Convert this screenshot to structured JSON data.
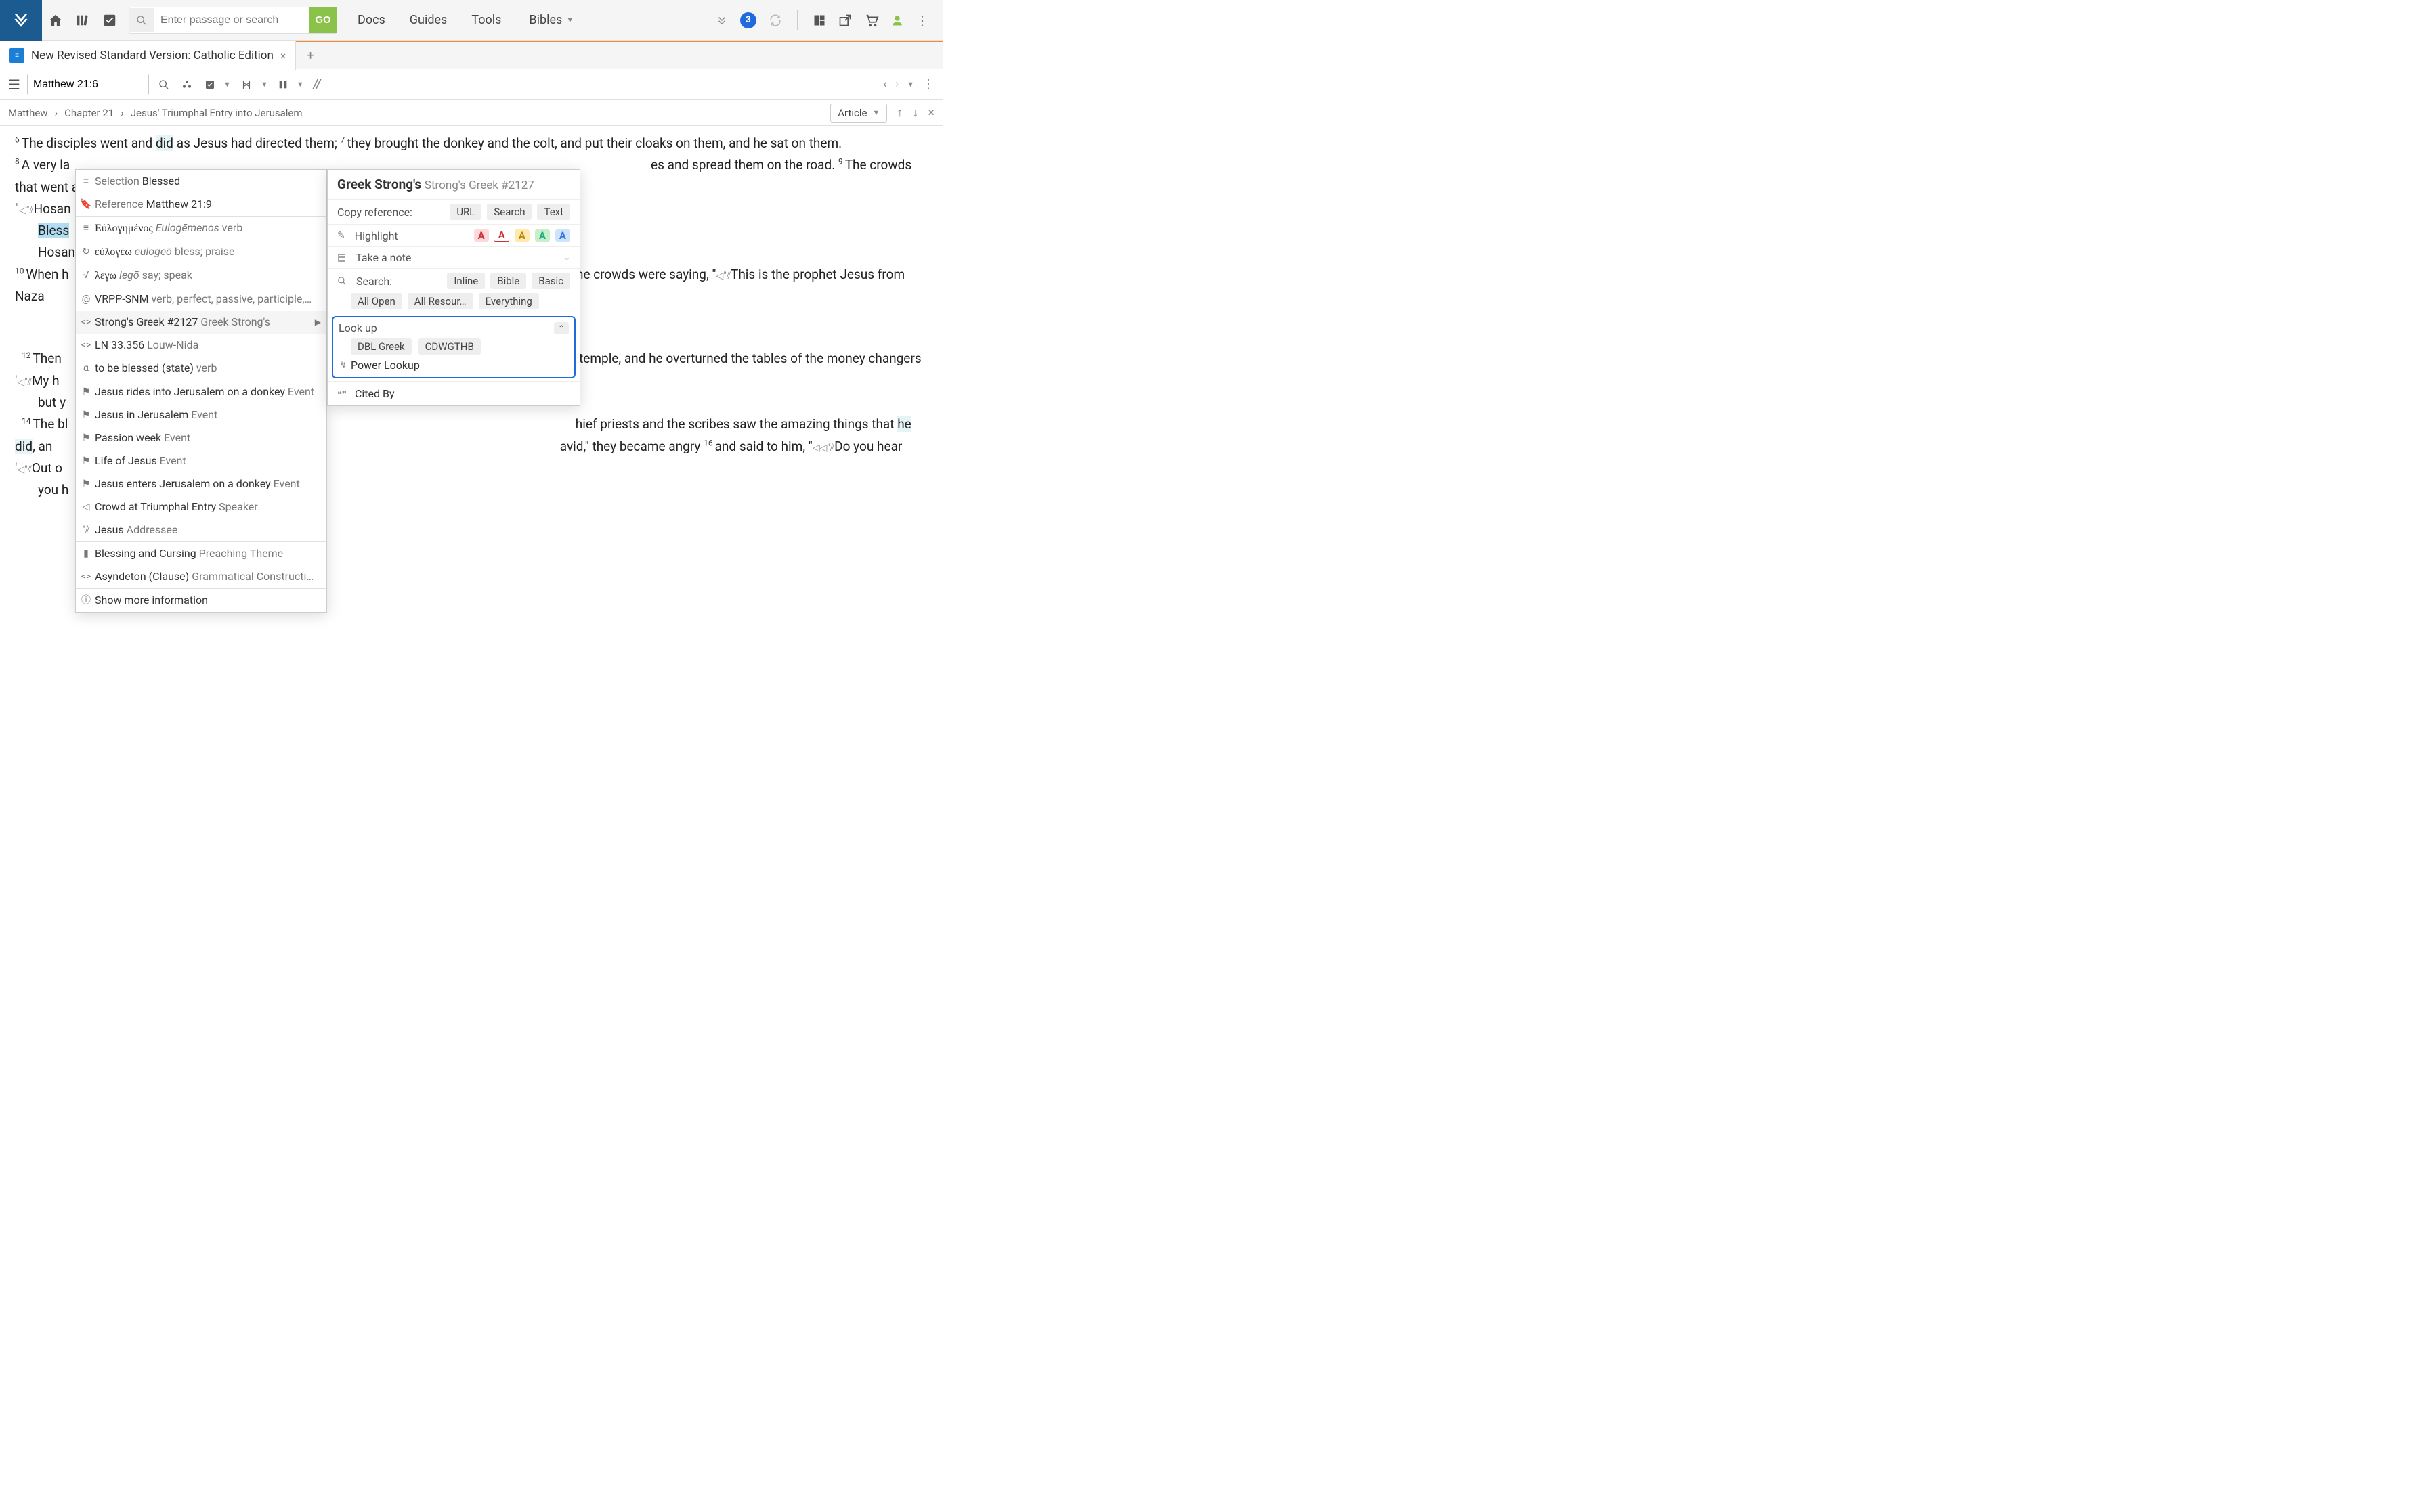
{
  "topbar": {
    "search_placeholder": "Enter passage or search",
    "go": "GO",
    "nav": {
      "docs": "Docs",
      "guides": "Guides",
      "tools": "Tools",
      "bibles": "Bibles"
    },
    "badge": "3"
  },
  "tab": {
    "title": "New Revised Standard Version: Catholic Edition"
  },
  "panel": {
    "reference": "Matthew 21:6"
  },
  "breadcrumb": {
    "b1": "Matthew",
    "b2": "Chapter 21",
    "b3": "Jesus' Triumphal Entry into Jerusalem",
    "article": "Article"
  },
  "verses": {
    "v6": "The disciples went and ",
    "v6_did": "did",
    "v6_rest": " as Jesus had directed them; ",
    "v7": "they brought the donkey and the colt, and put their cloaks on them, and he sat on them.",
    "v8": "A very la",
    "v8_tail": "es and spread them on the road. ",
    "v9a": "The crowds that went ahead of ",
    "v9_hosanna": "Hosan",
    "v9_blessed": "Bless",
    "v9_hosanna2": "Hosan",
    "v10": "When h",
    "v10_tail": "he crowds were saying, \"",
    "v10_tail2": "This is the prophet Jesus from Naza",
    "v12": "Then ",
    "v12_tail": "e temple, and he overturned the tables of the money changers",
    "v13a": "My h",
    "v13b": "but y",
    "v14a": "The bl",
    "v15a": "hief priests and the scribes saw the amazing things that ",
    "v15_hedid": "he did",
    "v15b": ", an",
    "v15c": "avid,\" they became angry ",
    "v16a": "and said to him, \"",
    "v16b": "Do you hear ",
    "v16c": "Out o",
    "v16d": "you h"
  },
  "ctx": {
    "selection_lbl": "Selection",
    "selection": "Blessed",
    "reference_lbl": "Reference",
    "reference": "Matthew 21:9",
    "lemma_gr": "Εὐλογημένος",
    "lemma_tr": "Eulogēmenos",
    "lemma_pos": "verb",
    "root_gr": "εὐλογέω",
    "root_tr": "eulogeō",
    "root_gloss": "bless; praise",
    "lego_gr": "λεγω",
    "lego_tr": "legō",
    "lego_gloss": "say; speak",
    "morph": "VRPP-SNM",
    "morph_gloss": "verb, perfect, passive, participle,…",
    "strongs": "Strong's Greek #2127",
    "strongs_lbl": "Greek Strong's",
    "ln": "LN 33.356",
    "ln_lbl": "Louw-Nida",
    "state": "to be blessed (state)",
    "state_pos": "verb",
    "ev1": "Jesus rides into Jerusalem on a donkey",
    "ev1_lbl": "Event",
    "ev2": "Jesus in Jerusalem",
    "ev2_lbl": "Event",
    "ev3": "Passion week",
    "ev3_lbl": "Event",
    "ev4": "Life of Jesus",
    "ev4_lbl": "Event",
    "ev5": "Jesus enters Jerusalem on a donkey",
    "ev5_lbl": "Event",
    "sp": "Crowd at Triumphal Entry",
    "sp_lbl": "Speaker",
    "addr": "Jesus",
    "addr_lbl": "Addressee",
    "theme": "Blessing and Cursing",
    "theme_lbl": "Preaching Theme",
    "gram": "Asyndeton (Clause)",
    "gram_lbl": "Grammatical Constructi…",
    "more": "Show more information"
  },
  "rpanel": {
    "title": "Greek Strong's",
    "subtitle": "Strong's Greek #2127",
    "copyref": "Copy reference:",
    "url": "URL",
    "search": "Search",
    "text": "Text",
    "highlight": "Highlight",
    "note": "Take a note",
    "search_lbl": "Search:",
    "inline": "Inline",
    "bible": "Bible",
    "basic": "Basic",
    "allopen": "All Open",
    "allres": "All Resour…",
    "everything": "Everything",
    "lookup": "Look up",
    "dbl": "DBL Greek",
    "cdw": "CDWGTHB",
    "power": "Power Lookup",
    "cited": "Cited By"
  }
}
